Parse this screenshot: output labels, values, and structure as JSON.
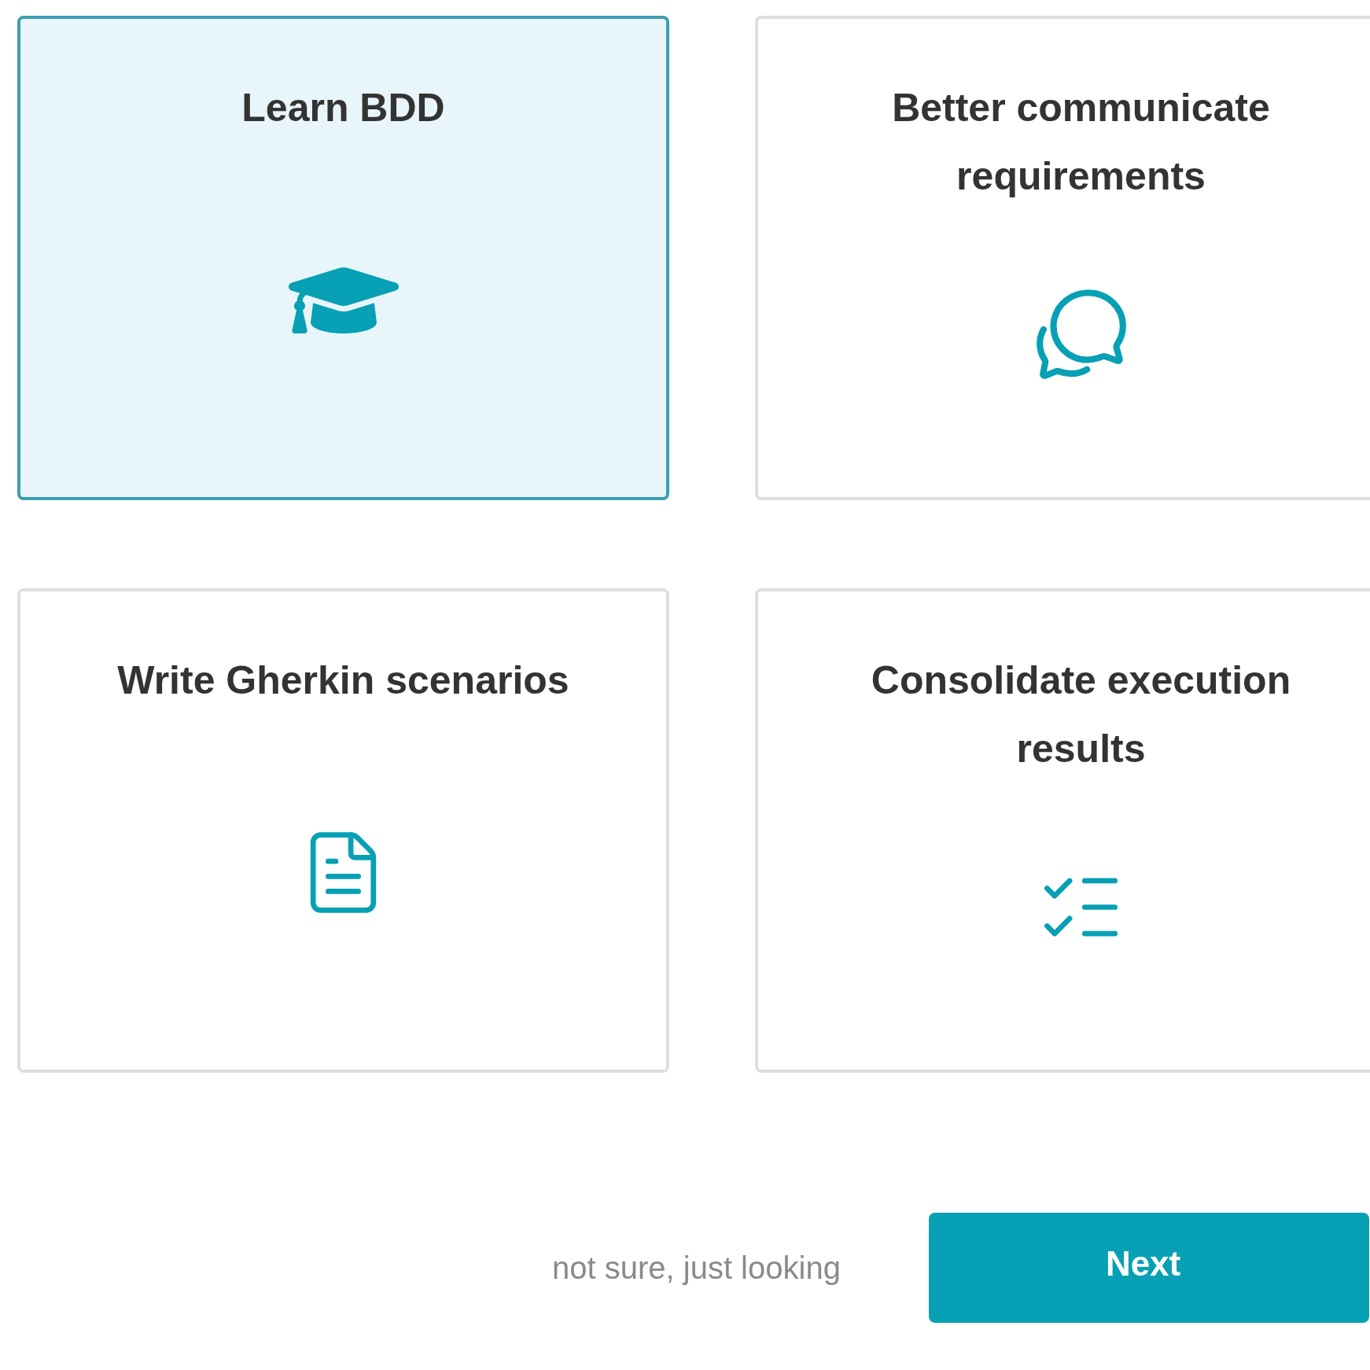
{
  "cards": [
    {
      "title": "Learn BDD",
      "kind": "cap",
      "selected": true
    },
    {
      "title": "Better communicate requirements",
      "kind": "chat",
      "selected": false
    },
    {
      "title": "Write Gherkin scenarios",
      "kind": "document",
      "selected": false
    },
    {
      "title": "Consolidate execution results",
      "kind": "checklist",
      "selected": false
    }
  ],
  "footer": {
    "link": "not sure, just looking",
    "button": "Next"
  }
}
